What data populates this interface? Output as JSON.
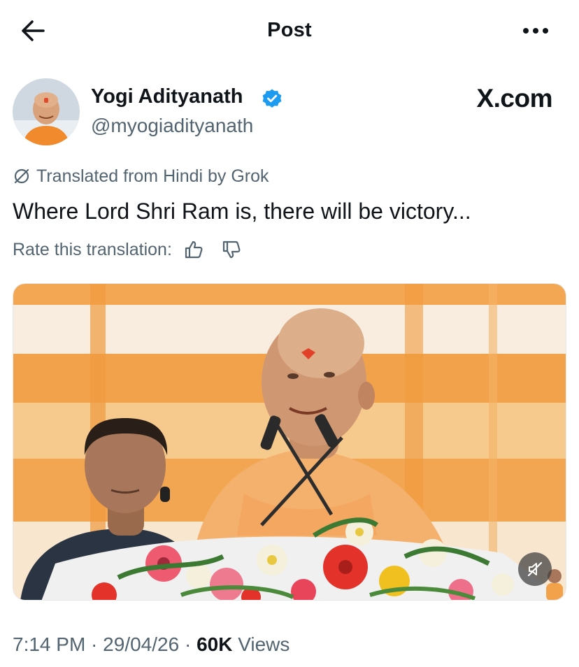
{
  "header": {
    "title": "Post",
    "back_icon": "arrow-left-icon",
    "more_icon": "more-horizontal-icon"
  },
  "author": {
    "display_name": "Yogi Adityanath",
    "handle": "@myogiadityanath",
    "verified": true,
    "verified_color": "#1d9bf0",
    "watermark": "X.com"
  },
  "translation": {
    "notice": "Translated from Hindi by Grok",
    "rate_label": "Rate this translation:",
    "thumbs_up_icon": "thumbs-up-icon",
    "thumbs_down_icon": "thumbs-down-icon"
  },
  "tweet": {
    "text": "Where Lord Shri Ram is, there will be victory..."
  },
  "media": {
    "type": "video",
    "muted": true,
    "mute_icon": "speaker-muted-icon"
  },
  "meta": {
    "time": "7:14 PM",
    "separator": " · ",
    "date": "29/04/26",
    "views_count": "60K",
    "views_label": " Views"
  },
  "colors": {
    "text_primary": "#0f1419",
    "text_secondary": "#536471",
    "saffron": "#f2a24a"
  }
}
